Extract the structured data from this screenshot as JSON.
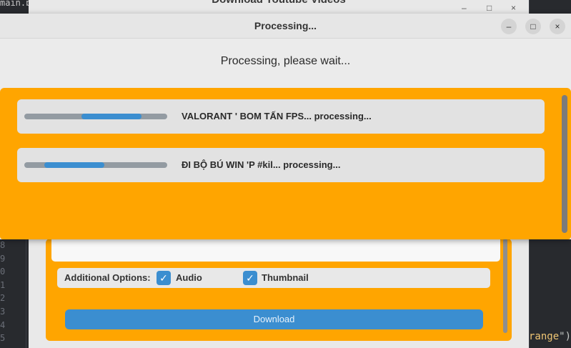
{
  "editor": {
    "tab_fragment": "main.py",
    "line_numbers": [
      "8",
      "9",
      "0",
      "1",
      "2",
      "3",
      "4",
      "5"
    ],
    "code_fragment_word": "range",
    "code_fragment_paren": "\")"
  },
  "background_window": {
    "title": "Download Youtube Videos",
    "options": {
      "label": "Additional Options:",
      "audio": {
        "label": "Audio",
        "checked": true
      },
      "thumbnail": {
        "label": "Thumbnail",
        "checked": true
      }
    },
    "download_button": "Download"
  },
  "dialog": {
    "title": "Processing...",
    "status": "Processing, please wait...",
    "window_controls": {
      "minimize": "–",
      "maximize": "□",
      "close": "×"
    },
    "items": [
      {
        "label": "VALORANT ' BOM TẤN FPS... processing...",
        "progress_start": 0.4,
        "progress_end": 0.82
      },
      {
        "label": "ĐI BỘ BÚ WIN 'P #kil... processing...",
        "progress_start": 0.14,
        "progress_end": 0.56
      }
    ],
    "colors": {
      "accent": "#3b8ed0",
      "panel": "#ffa500"
    }
  }
}
